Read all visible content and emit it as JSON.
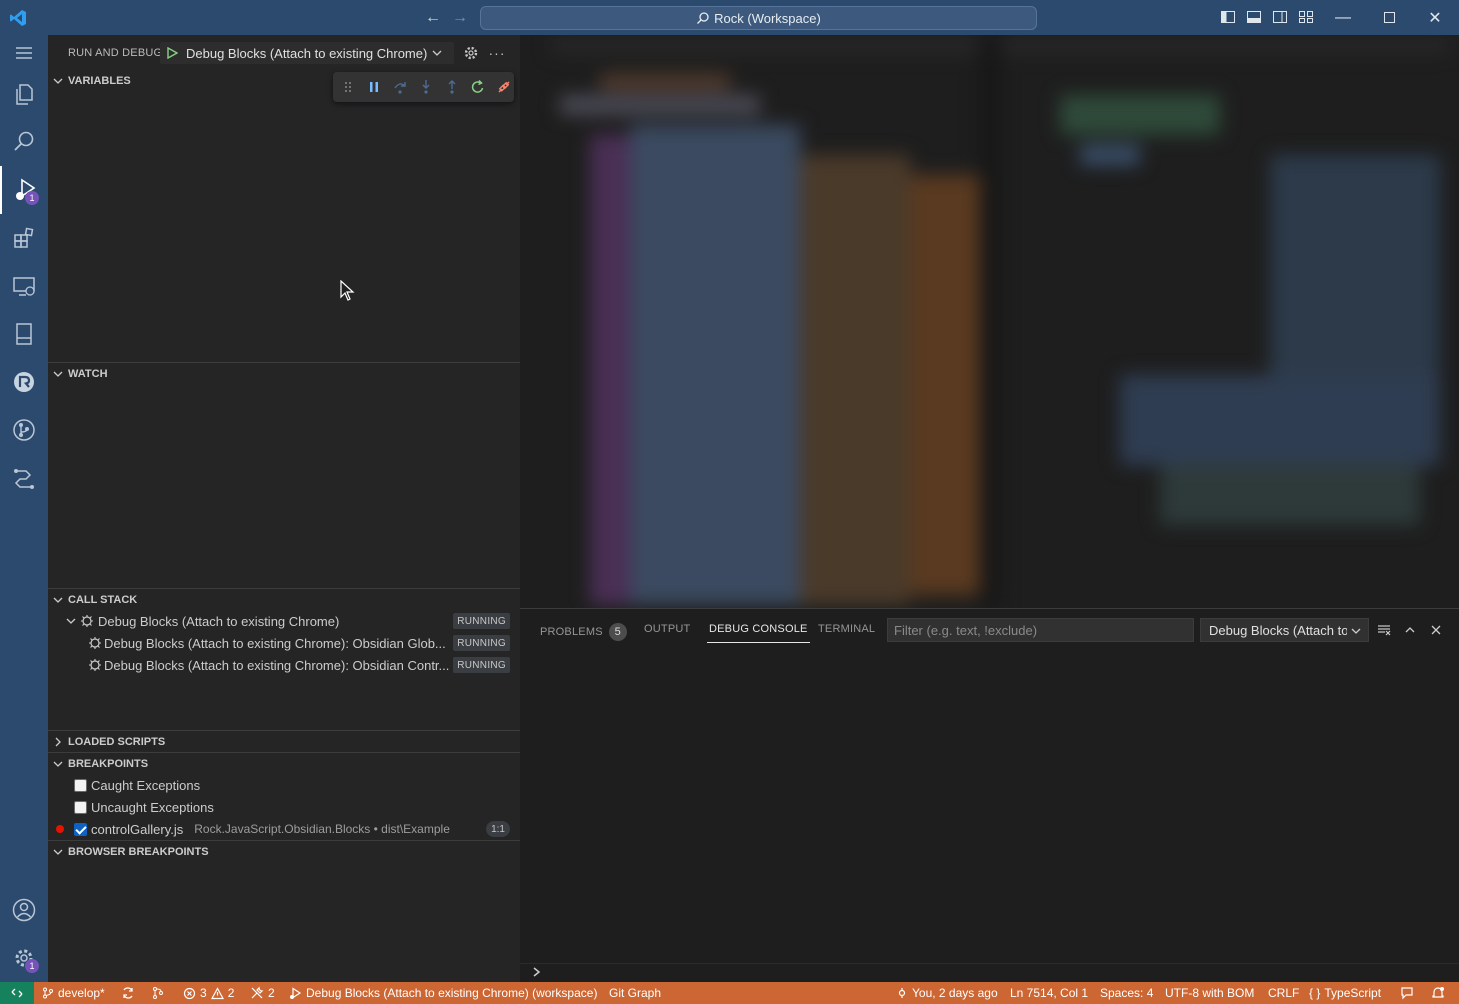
{
  "titlebar": {
    "workspace": "Rock (Workspace)"
  },
  "activity": {
    "run_badge": "1",
    "manage_badge": "1"
  },
  "sidebar": {
    "title": "RUN AND DEBUG",
    "config": "Debug Blocks (Attach to existing Chrome)",
    "sections": {
      "variables": "VARIABLES",
      "watch": "WATCH",
      "call_stack": "CALL STACK",
      "loaded_scripts": "LOADED SCRIPTS",
      "breakpoints": "BREAKPOINTS",
      "browser_breakpoints": "BROWSER BREAKPOINTS"
    },
    "call_stack": [
      {
        "label": "Debug Blocks (Attach to existing Chrome)",
        "status": "RUNNING"
      },
      {
        "label": "Debug Blocks (Attach to existing Chrome): Obsidian Glob...",
        "status": "RUNNING"
      },
      {
        "label": "Debug Blocks (Attach to existing Chrome): Obsidian Contr...",
        "status": "RUNNING"
      }
    ],
    "breakpoints": {
      "caught": "Caught Exceptions",
      "uncaught": "Uncaught Exceptions",
      "file": "controlGallery.js",
      "path": "Rock.JavaScript.Obsidian.Blocks • dist\\Example",
      "line": "1:1"
    }
  },
  "panel": {
    "tabs": [
      "PROBLEMS",
      "OUTPUT",
      "DEBUG CONSOLE",
      "TERMINAL"
    ],
    "problems_count": "5",
    "filter_placeholder": "Filter (e.g. text, !exclude)",
    "session": "Debug Blocks (Attach to existing Chrome)"
  },
  "statusbar": {
    "branch": "develop*",
    "errors": "3",
    "warnings": "2",
    "ports": "2",
    "debug_session": "Debug Blocks (Attach to existing Chrome) (workspace)",
    "git_graph": "Git Graph",
    "blame": "You, 2 days ago",
    "position": "Ln 7514, Col 1",
    "spaces": "Spaces: 4",
    "encoding": "UTF-8 with BOM",
    "eol": "CRLF",
    "language": "TypeScript"
  },
  "colors": {
    "titlebar": "#2c4a6e",
    "statusbar_debug": "#cc6633",
    "remote": "#16825d",
    "breakpoint": "#e51400",
    "badge": "#7553b8"
  }
}
